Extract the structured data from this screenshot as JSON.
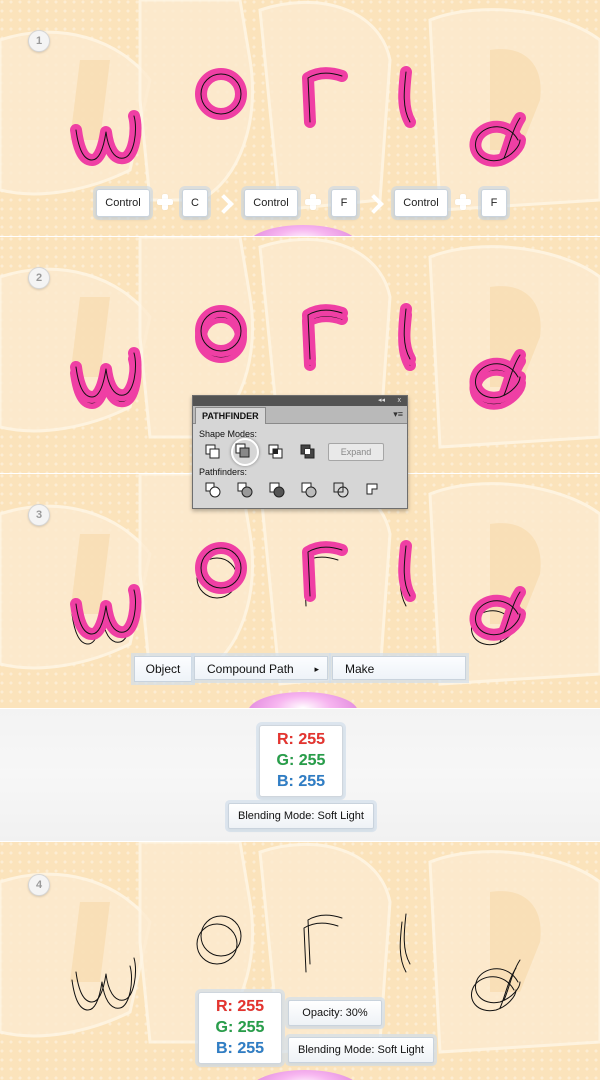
{
  "steps": [
    "1",
    "2",
    "3",
    "4"
  ],
  "shortcuts": {
    "keys": [
      "Control",
      "C",
      "Control",
      "F",
      "Control",
      "F"
    ]
  },
  "pathfinder": {
    "tab_label": "PATHFINDER",
    "shape_modes_label": "Shape Modes:",
    "pathfinders_label": "Pathfinders:",
    "expand_label": "Expand",
    "collapse_glyph": "◂◂",
    "close_glyph": "x",
    "menu_glyph": "▾≡"
  },
  "menu_path": {
    "object_label": "Object",
    "compound_path_label": "Compound Path",
    "arrow_glyph": "▸",
    "make_label": "Make"
  },
  "fill_settings_1": {
    "r": "R: 255",
    "g": "G: 255",
    "b": "B: 255",
    "blending_mode": "Blending Mode: Soft Light"
  },
  "fill_settings_2": {
    "r": "R: 255",
    "g": "G: 255",
    "b": "B: 255",
    "opacity": "Opacity: 30%",
    "blending_mode": "Blending Mode: Soft Light"
  },
  "colors": {
    "background_peach": "#fbe3bb",
    "letter_pink": "#ef3fa4",
    "r_red": "#e8342f",
    "g_green": "#27a04a",
    "b_blue": "#2f7fc8"
  }
}
